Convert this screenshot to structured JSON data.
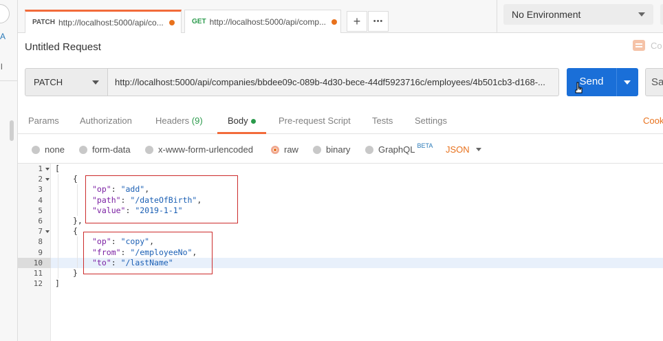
{
  "left_strip": {
    "glyph_a": "A",
    "glyph_l": "l"
  },
  "tabs": [
    {
      "method": "PATCH",
      "url": "http://localhost:5000/api/co...",
      "unsaved": true,
      "active": true
    },
    {
      "method": "GET",
      "url": "http://localhost:5000/api/comp...",
      "unsaved": true,
      "active": false
    }
  ],
  "tab_actions": {
    "add": "+",
    "more": "•••"
  },
  "environment": {
    "selected": "No Environment"
  },
  "request": {
    "title": "Untitled Request",
    "comments_label": "Co",
    "method": "PATCH",
    "url": "http://localhost:5000/api/companies/bbdee09c-089b-4d30-bece-44df5923716c/employees/4b501cb3-d168-...",
    "send_label": "Send",
    "save_label": "Sa"
  },
  "request_tabs": [
    {
      "label": "Params"
    },
    {
      "label": "Authorization"
    },
    {
      "label": "Headers",
      "count": "(9)"
    },
    {
      "label": "Body",
      "active": true,
      "indicator": true
    },
    {
      "label": "Pre-request Script"
    },
    {
      "label": "Tests"
    },
    {
      "label": "Settings"
    }
  ],
  "cookies_label": "Cook",
  "body_types": [
    {
      "label": "none",
      "selected": false
    },
    {
      "label": "form-data",
      "selected": false
    },
    {
      "label": "x-www-form-urlencoded",
      "selected": false
    },
    {
      "label": "raw",
      "selected": true
    },
    {
      "label": "binary",
      "selected": false
    },
    {
      "label": "GraphQL",
      "badge": "BETA",
      "selected": false
    }
  ],
  "body_format": "JSON",
  "editor": {
    "line_numbers": [
      "1",
      "2",
      "3",
      "4",
      "5",
      "6",
      "7",
      "8",
      "9",
      "10",
      "11",
      "12"
    ],
    "highlighted_line": 10,
    "lines": {
      "l1": "[",
      "l2": "{",
      "l3_key": "\"op\"",
      "l3_val": "\"add\"",
      "l4_key": "\"path\"",
      "l4_val": "\"/dateOfBirth\"",
      "l5_key": "\"value\"",
      "l5_val": "\"2019-1-1\"",
      "l6": "},",
      "l7": "{",
      "l8_key": "\"op\"",
      "l8_val": "\"copy\"",
      "l9_key": "\"from\"",
      "l9_val": "\"/employeeNo\"",
      "l10_key": "\"to\"",
      "l10_val": "\"/lastName\"",
      "l11": "}",
      "l12": "]"
    }
  },
  "colors": {
    "accent": "#f26b3a",
    "send": "#1a6fd8",
    "key": "#7a1fa2",
    "string": "#1a5fb4",
    "annotation_box": "#cc2b2b"
  }
}
